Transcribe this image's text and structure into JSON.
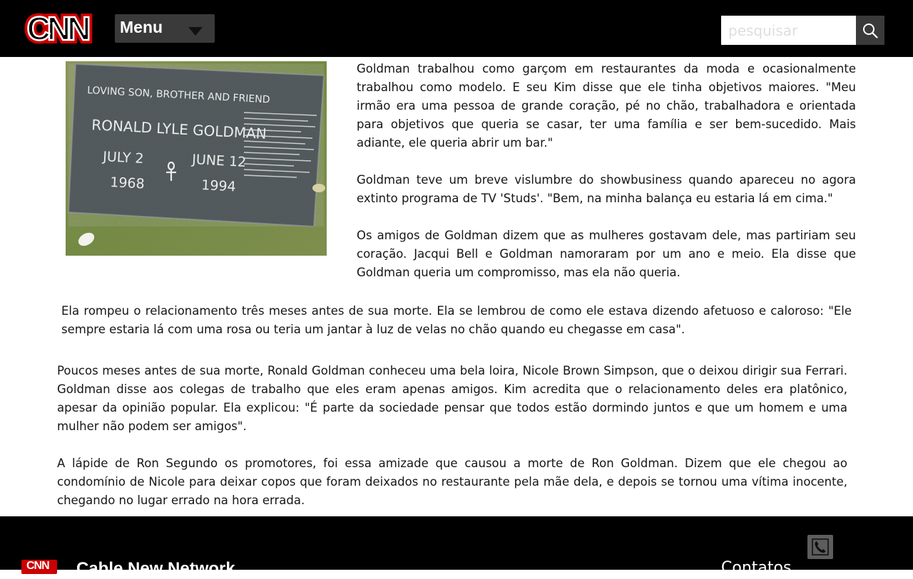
{
  "header": {
    "logo_text": "CNN",
    "logo_color": "#cc0000",
    "menu_label": "Menu",
    "menu_icon": "caret-down-icon",
    "search_placeholder": "pesquisar",
    "search_icon": "search-icon"
  },
  "article": {
    "image_caption_lines": [
      "LOVING SON, BROTHER AND FRIEND",
      "RONALD LYLE GOLDMAN",
      "JULY 2",
      "1968",
      "JUNE 12",
      "1994"
    ],
    "paragraphs": [
      "Goldman trabalhou como garçom em restaurantes da moda e ocasionalmente trabalhou como modelo. E seu Kim disse que ele tinha objetivos maiores. \"Meu irmão era uma pessoa de grande coração, pé no chão, trabalhadora e orientada para objetivos que queria se casar, ter uma família e ser bem-sucedido. Mais adiante, ele queria abrir um bar.\"",
      "Goldman teve um breve vislumbre do showbusiness quando apareceu no agora extinto programa de TV 'Studs'. \"Bem, na minha balança eu estaria lá em cima.\"",
      "Os amigos de Goldman dizem que as mulheres gostavam dele, mas partiriam seu coração. Jacqui Bell e Goldman namoraram por um ano e meio. Ela disse que Goldman queria um compromisso, mas ela não queria.",
      "Ela rompeu o relacionamento três meses antes de sua morte. Ela se lembrou de como ele estava dizendo afetuoso e caloroso: \"Ele sempre estaria lá com uma rosa ou teria um jantar à luz de velas no chão quando eu chegasse em casa\".",
      "Poucos meses antes de sua morte, Ronald Goldman conheceu uma bela loira, Nicole Brown Simpson, que o deixou dirigir sua Ferrari. Goldman disse aos colegas de trabalho que eles eram apenas amigos. Kim acredita que o relacionamento deles era platônico, apesar da opinião popular. Ela explicou: \"É parte da sociedade pensar que todos estão dormindo juntos e que um homem e uma mulher não podem ser amigos\".",
      "A lápide de Ron Segundo os promotores, foi essa amizade que causou a morte de Ron Goldman. Dizem que ele chegou ao condomínio de Nicole para deixar copos que foram deixados no restaurante pela mãe dela, e depois se tornou uma vítima inocente, chegando no lugar errado na hora errada."
    ]
  },
  "footer": {
    "logo_text": "CNN",
    "title": "Cable New Network",
    "contacts_label": "Contatos",
    "phone_icon": "phone-icon"
  }
}
